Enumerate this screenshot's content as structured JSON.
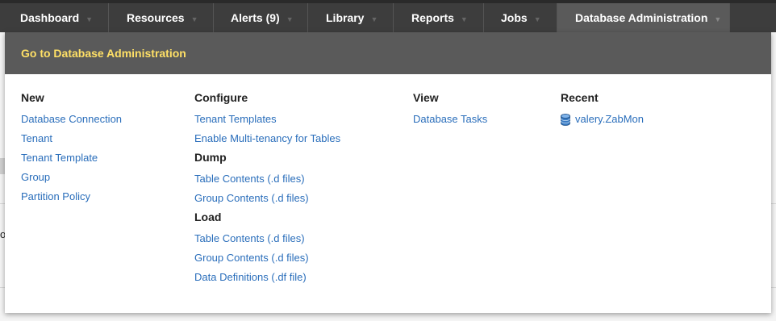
{
  "nav": {
    "items": [
      {
        "label": "Dashboard"
      },
      {
        "label": "Resources"
      },
      {
        "label": "Alerts (9)"
      },
      {
        "label": "Library"
      },
      {
        "label": "Reports"
      },
      {
        "label": "Jobs"
      },
      {
        "label": "Database Administration"
      }
    ],
    "caret": "▼"
  },
  "background": {
    "fragment_char": "o"
  },
  "menu": {
    "header_link": "Go to Database Administration",
    "new": {
      "heading": "New",
      "links": [
        "Database Connection",
        "Tenant",
        "Tenant Template",
        "Group",
        "Partition Policy"
      ]
    },
    "configure": {
      "heading": "Configure",
      "links": [
        "Tenant Templates",
        "Enable Multi-tenancy for Tables"
      ]
    },
    "dump": {
      "heading": "Dump",
      "links": [
        "Table Contents (.d files)",
        "Group Contents (.d files)"
      ]
    },
    "load": {
      "heading": "Load",
      "links": [
        "Table Contents (.d files)",
        "Group Contents (.d files)",
        "Data Definitions (.df file)"
      ]
    },
    "view": {
      "heading": "View",
      "links": [
        "Database Tasks"
      ]
    },
    "recent": {
      "heading": "Recent",
      "icon": "database-icon",
      "links": [
        "valery.ZabMon"
      ]
    }
  },
  "colors": {
    "nav_bg": "#3d3d3d",
    "active_bg": "#5a5a5a",
    "header_link": "#ffe066",
    "link": "#2a6ebb"
  }
}
